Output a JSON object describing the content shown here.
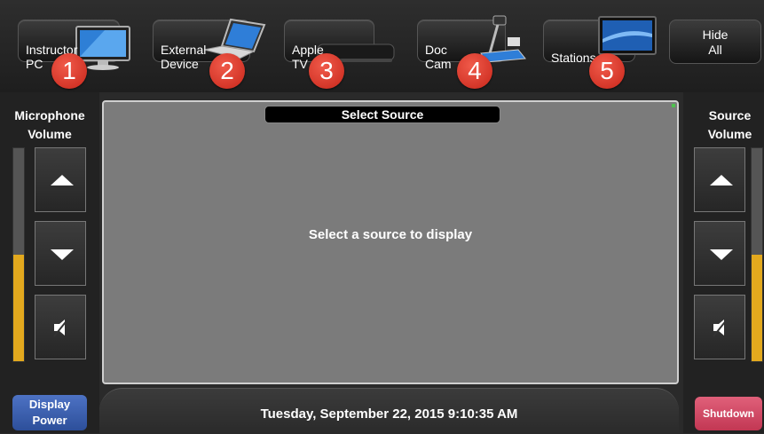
{
  "sources": [
    {
      "label": "Instructor\nPC",
      "number": "1",
      "icon": "desktop-monitor-icon"
    },
    {
      "label": "External\nDevice",
      "number": "2",
      "icon": "laptop-icon"
    },
    {
      "label": "Apple\nTV",
      "number": "3",
      "icon": "apple-tv-box-icon"
    },
    {
      "label": "Doc\nCam",
      "number": "4",
      "icon": "document-camera-icon"
    },
    {
      "label": "Stations",
      "number": "5",
      "icon": "flat-screen-icon"
    }
  ],
  "hide_all": {
    "label": "Hide\nAll"
  },
  "left_panel": {
    "title": "Microphone\nVolume",
    "level": 0.5,
    "mute_icon": "speaker-mute-icon"
  },
  "right_panel": {
    "title": "Source\nVolume",
    "level": 0.5,
    "mute_icon": "speaker-mute-icon"
  },
  "main": {
    "title": "Select Source",
    "message": "Select a source to display"
  },
  "footer": {
    "datetime": "Tuesday, September 22, 2015 9:10:35 AM"
  },
  "buttons": {
    "display_power": "Display\nPower",
    "shutdown": "Shutdown"
  },
  "colors": {
    "meter_fill": "#e3a91e",
    "number_badge": "#d9352a",
    "display_power": "#3a5fb0",
    "shutdown": "#d24a66"
  }
}
